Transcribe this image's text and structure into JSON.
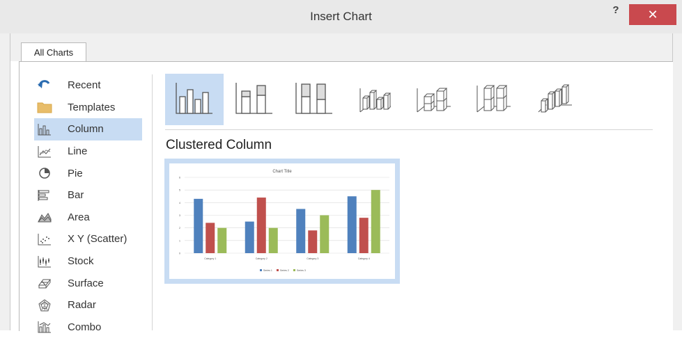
{
  "dialog": {
    "title": "Insert Chart",
    "help_label": "?",
    "close_label": "✕"
  },
  "tabs": [
    {
      "label": "All Charts",
      "selected": true
    }
  ],
  "chart_types": [
    {
      "label": "Recent",
      "icon": "undo-arrow-icon"
    },
    {
      "label": "Templates",
      "icon": "folder-icon"
    },
    {
      "label": "Column",
      "icon": "column-chart-icon",
      "selected": true
    },
    {
      "label": "Line",
      "icon": "line-chart-icon"
    },
    {
      "label": "Pie",
      "icon": "pie-chart-icon"
    },
    {
      "label": "Bar",
      "icon": "bar-chart-icon"
    },
    {
      "label": "Area",
      "icon": "area-chart-icon"
    },
    {
      "label": "X Y (Scatter)",
      "icon": "scatter-chart-icon"
    },
    {
      "label": "Stock",
      "icon": "stock-chart-icon"
    },
    {
      "label": "Surface",
      "icon": "surface-chart-icon"
    },
    {
      "label": "Radar",
      "icon": "radar-chart-icon"
    },
    {
      "label": "Combo",
      "icon": "combo-chart-icon"
    }
  ],
  "column_subtypes": [
    {
      "icon": "clustered-column-icon",
      "selected": true
    },
    {
      "icon": "stacked-column-icon"
    },
    {
      "icon": "100-stacked-column-icon"
    },
    {
      "icon": "3d-clustered-column-icon"
    },
    {
      "icon": "3d-stacked-column-icon"
    },
    {
      "icon": "3d-100-stacked-column-icon"
    },
    {
      "icon": "3d-column-icon"
    }
  ],
  "selected_subtype_name": "Clustered Column",
  "colors": {
    "selection": "#c8dcf3",
    "close_button": "#c9494e",
    "series": [
      "#4f81bd",
      "#c0504d",
      "#9bbb59"
    ]
  },
  "chart_data": {
    "type": "bar",
    "title": "Chart Title",
    "categories": [
      "Category 1",
      "Category 2",
      "Category 3",
      "Category 4"
    ],
    "series": [
      {
        "name": "Series 1",
        "values": [
          4.3,
          2.5,
          3.5,
          4.5
        ]
      },
      {
        "name": "Series 2",
        "values": [
          2.4,
          4.4,
          1.8,
          2.8
        ]
      },
      {
        "name": "Series 3",
        "values": [
          2,
          2,
          3,
          5
        ]
      }
    ],
    "ylim": [
      0,
      6
    ],
    "yticks": [
      "0",
      "1",
      "2",
      "3",
      "4",
      "5",
      "6"
    ],
    "grid": true,
    "legend": "bottom"
  }
}
